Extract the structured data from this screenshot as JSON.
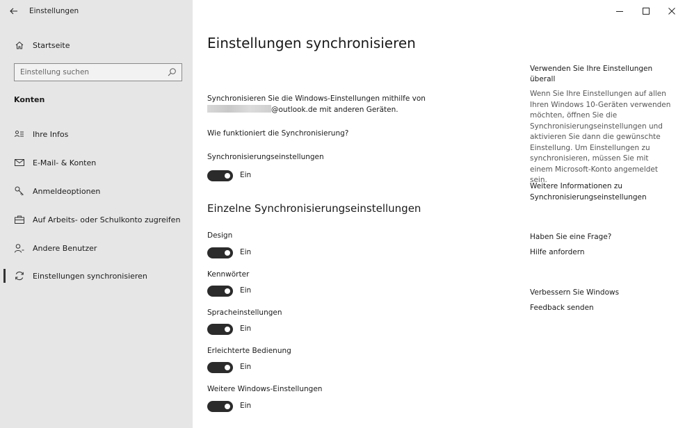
{
  "window": {
    "title": "Einstellungen",
    "controls": {
      "minimize": "–",
      "maximize": "□",
      "close": "×"
    }
  },
  "sidebar": {
    "home_label": "Startseite",
    "search_placeholder": "Einstellung suchen",
    "section": "Konten",
    "items": [
      {
        "label": "Ihre Infos",
        "icon": "person-list-icon"
      },
      {
        "label": "E-Mail- & Konten",
        "icon": "mail-icon"
      },
      {
        "label": "Anmeldeoptionen",
        "icon": "key-icon"
      },
      {
        "label": "Auf Arbeits- oder Schulkonto zugreifen",
        "icon": "briefcase-icon"
      },
      {
        "label": "Andere Benutzer",
        "icon": "user-add-icon"
      },
      {
        "label": "Einstellungen synchronisieren",
        "icon": "sync-icon",
        "active": true
      }
    ]
  },
  "main": {
    "title": "Einstellungen synchronisieren",
    "description_line1": "Synchronisieren Sie die Windows-Einstellungen mithilfe von",
    "description_line2": "@outlook.de mit anderen Geräten.",
    "how_link": "Wie funktioniert die Synchronisierung?",
    "master_setting": {
      "label": "Synchronisierungseinstellungen",
      "state": "Ein"
    },
    "individual_title": "Einzelne Synchronisierungseinstellungen",
    "individual_settings": [
      {
        "label": "Design",
        "state": "Ein"
      },
      {
        "label": "Kennwörter",
        "state": "Ein"
      },
      {
        "label": "Spracheinstellungen",
        "state": "Ein"
      },
      {
        "label": "Erleichterte Bedienung",
        "state": "Ein"
      },
      {
        "label": "Weitere Windows-Einstellungen",
        "state": "Ein"
      }
    ]
  },
  "right": {
    "heading1": "Verwenden Sie Ihre Einstellungen überall",
    "text1": "Wenn Sie Ihre Einstellungen auf allen Ihren Windows 10-Geräten verwenden möchten, öffnen Sie die Synchronisierungseinstellungen und aktivieren Sie dann die gewünschte Einstellung. Um Einstellungen zu synchronisieren, müssen Sie mit einem Microsoft-Konto angemeldet sein.",
    "link1": "Weitere Informationen zu Synchronisierungseinstellungen",
    "heading2": "Haben Sie eine Frage?",
    "link2": "Hilfe anfordern",
    "heading3": "Verbessern Sie Windows",
    "link3": "Feedback senden"
  }
}
